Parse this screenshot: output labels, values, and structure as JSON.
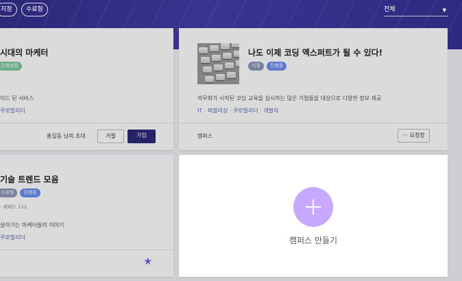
{
  "filters": {
    "chip1": "지정",
    "chip2": "수료형"
  },
  "sort_select": {
    "value": "전체"
  },
  "colors": {
    "header_band": "#2e2a80",
    "button_primary": "#2d2a7a",
    "plus": "#c7a9ff",
    "star": "#7a66e0"
  },
  "card1": {
    "title": "시대의 마케터",
    "badges": [
      "진행예정"
    ],
    "desc": "이드 된 서비스",
    "tags": "쿠로빌리더",
    "invite_text": "홍길동 님의 초대",
    "reject_label": "거절",
    "join_label": "가입"
  },
  "card2": {
    "title": "나도 이제 코딩 엑스퍼트가 될 수 있다!",
    "badges": [
      "지정",
      "진행중"
    ],
    "desc": "의무화가 시작된 코딩 교육을 실시하는 많은 기업들을 대상으로 다양한 정보 제공",
    "tags": "IT · 퍼블리싱 · 쿠로빌리더 · 개발자",
    "footer_label": "캠퍼스",
    "request_label": "··· 요청함"
  },
  "card3": {
    "title": "기술 트렌드 모음",
    "badges": [
      "수료형",
      "진행중"
    ],
    "meta": "· 세찌드 112",
    "desc": "살아가는 마케터들의 이야기",
    "tags": "쿠로빌리더",
    "star_icon": "star-icon"
  },
  "create_card": {
    "label": "캠퍼스 만들기",
    "icon": "plus-icon"
  }
}
